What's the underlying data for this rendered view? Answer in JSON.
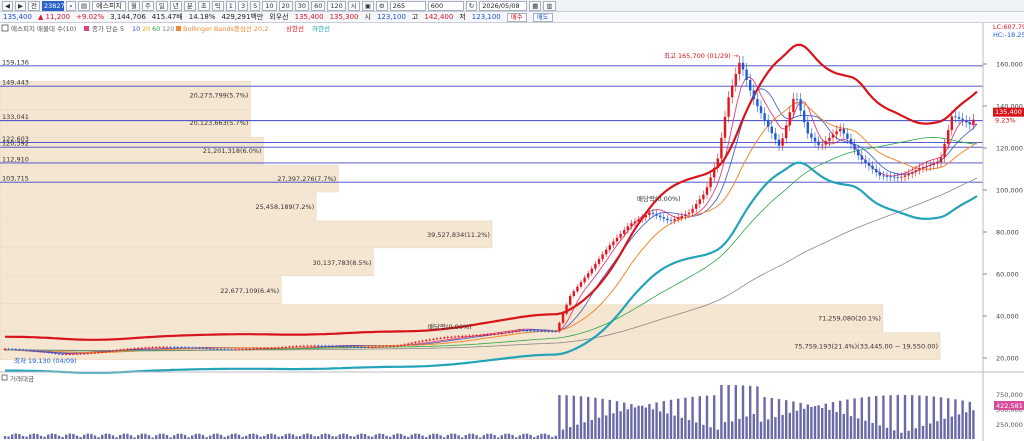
{
  "toolbar": {
    "nav_buttons": [
      "◀",
      "▶",
      "전"
    ],
    "stock_code": "238270",
    "stock_name": "에스피지",
    "period_buttons": [
      "월",
      "주",
      "일",
      "년",
      "분",
      "초",
      "틱"
    ],
    "interval_buttons": [
      "1",
      "3",
      "5",
      "10",
      "20",
      "30",
      "60",
      "120"
    ],
    "extra_buttons": [
      "시"
    ],
    "count_value": "265",
    "count_total": "600",
    "date_value": "2026/05/08"
  },
  "quote": {
    "price": "135,400",
    "change": "▲ 11,200",
    "change_pct": "+9.02%",
    "volume": "3,144,706",
    "amount": "415.47배",
    "turnover": "14.18%",
    "market_cap": "429,291백만",
    "label_prev": "외우선",
    "open": "135,400",
    "high_label": "135,300",
    "val1": "시",
    "low": "123,100",
    "label_high": "고",
    "high": "142,400",
    "label_low": "저",
    "low2": "123,100",
    "buy_button": "매수",
    "sell_button": "매도"
  },
  "legend": {
    "box": "에스피지 매물대 수(10)",
    "ma": "종가 단순 5",
    "ma_periods": [
      "10",
      "20",
      "60",
      "120"
    ],
    "bollinger": "Bollinger Bands중심선 20,2",
    "upper": "상한선",
    "lower": "하한선",
    "corner_lc": "LC:607.79",
    "corner_hc": "HC:-18.25"
  },
  "hlines": [
    {
      "label": "159,136",
      "value": 159136
    },
    {
      "label": "149,443",
      "value": 149443
    },
    {
      "label": "133,041",
      "value": 133041
    },
    {
      "label": "122,603",
      "value": 122603
    },
    {
      "label": "120,392",
      "value": 120392
    },
    {
      "label": "112,910",
      "value": 112910
    },
    {
      "label": "103,715",
      "value": 103715
    }
  ],
  "volume_profile": [
    {
      "label": "20,273,799(5.7%)",
      "pct": 5.7
    },
    {
      "label": "20,123,663(5.7%)",
      "pct": 5.7
    },
    {
      "label": "21,201,318(6.0%)",
      "pct": 6.0
    },
    {
      "label": "27,397,276(7.7%)",
      "pct": 7.7
    },
    {
      "label": "25,458,189(7.2%)",
      "pct": 7.2
    },
    {
      "label": "39,527,834(11.2%)",
      "pct": 11.2
    },
    {
      "label": "30,137,783(8.5%)",
      "pct": 8.5
    },
    {
      "label": "22,677,109(6.4%)",
      "pct": 6.4
    },
    {
      "label": "71,259,080(20.1%)",
      "pct": 20.1
    },
    {
      "label": "75,759,193(21.4%)(33,445.00 ~ 19,550.00)",
      "pct": 21.4
    }
  ],
  "price_axis": {
    "ticks": [
      "160,000",
      "140,000",
      "120,000",
      "100,000",
      "80,000",
      "60,000",
      "40,000",
      "20,000"
    ],
    "tick_values": [
      160000,
      140000,
      120000,
      100000,
      80000,
      60000,
      40000,
      20000
    ],
    "current_label": "135,400",
    "current_pct": "9.23%"
  },
  "annotations": {
    "high": "최고 165,700 (01/29) →",
    "ex_dividend_1": "배당락(0.00%)",
    "ex_dividend_2": "배당락(0.00%)",
    "low": "최저 19,130 (04/09)"
  },
  "volume_panel": {
    "title": "거래대금",
    "ticks": [
      "750,000",
      "500,000",
      "250,000"
    ],
    "current": "422,581"
  },
  "colors": {
    "up": "#e8141c",
    "down": "#1f5bd8",
    "ma5": "#e0407a",
    "ma10": "#3953c8",
    "ma20": "#e8b000",
    "ma60": "#2aa84a",
    "ma120": "#888888",
    "bb_mid": "#f08a30",
    "bb_upper": "#d8141a",
    "bb_lower": "#23a3b8",
    "hline": "#3d44c8",
    "profile": "#f5e6d2",
    "volume": "#6a6aa8"
  }
}
